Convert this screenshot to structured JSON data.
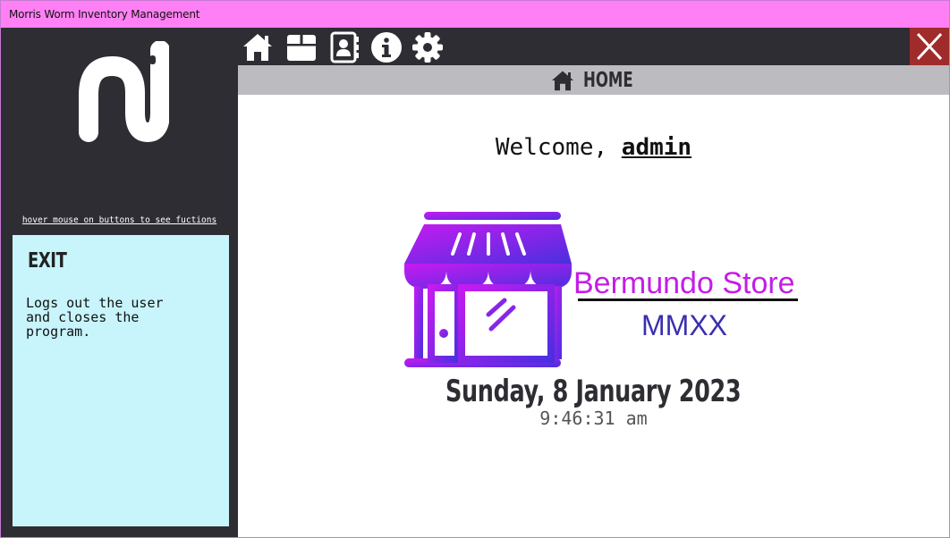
{
  "window": {
    "title": "Morris Worm Inventory Management"
  },
  "sidebar": {
    "hint": "hover mouse on buttons to see fuctions",
    "info": {
      "title": "EXIT",
      "description": "Logs out the user\nand closes the\nprogram."
    }
  },
  "toolbar": {
    "icons": [
      "home-icon",
      "box-icon",
      "contacts-icon",
      "info-icon",
      "gear-icon"
    ],
    "close_icon": "close-icon"
  },
  "header": {
    "title": "HOME",
    "icon": "home-icon"
  },
  "main": {
    "welcome_prefix": "Welcome, ",
    "username": "admin",
    "store_name": "Bermundo Store",
    "store_year": "MMXX",
    "date": "Sunday, 8 January 2023",
    "time": "9:46:31 am"
  },
  "colors": {
    "titlebar": "#ff80f4",
    "panel": "#2e2d33",
    "header": "#bcbbc0",
    "info_panel": "#c8f4fc",
    "close": "#a02b2b",
    "store_text": "#c41de6",
    "store_year": "#3a2fb0"
  }
}
